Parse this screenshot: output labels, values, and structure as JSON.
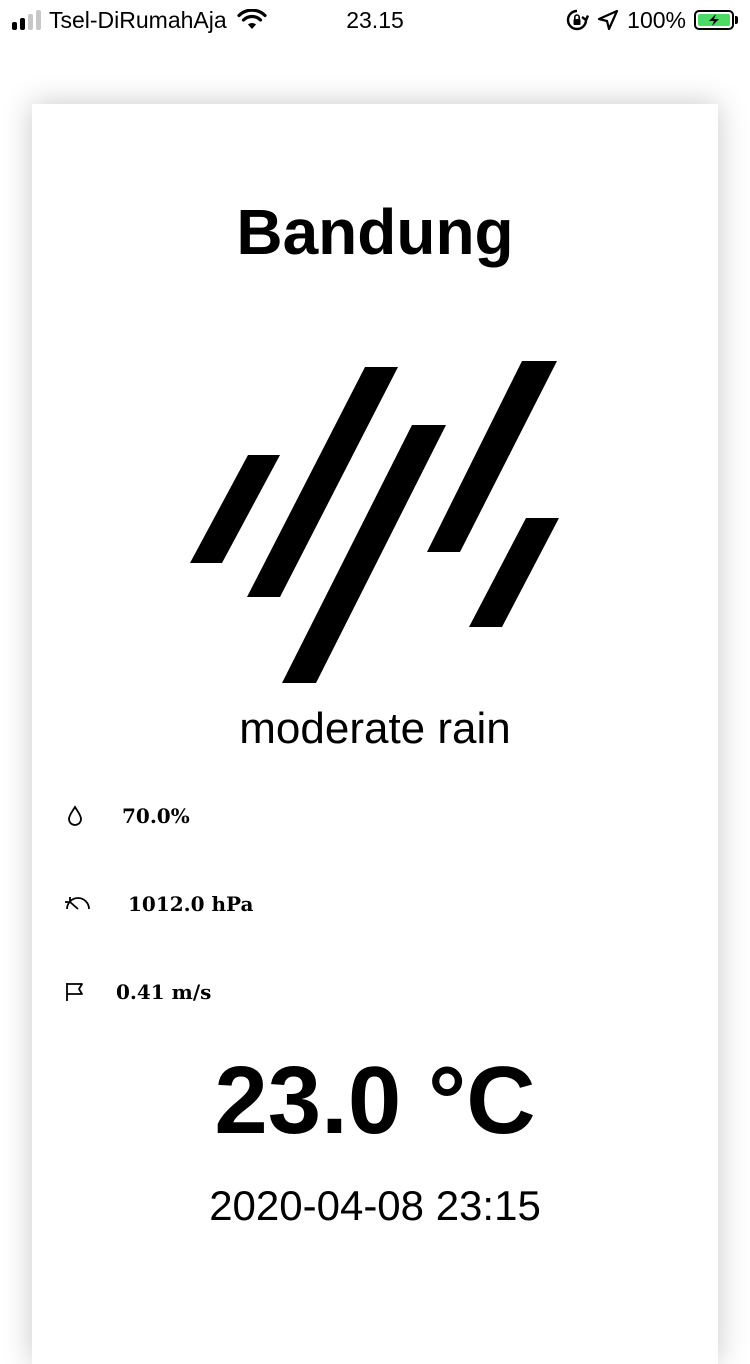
{
  "status_bar": {
    "carrier": "Tsel-DiRumahAja",
    "time": "23.15",
    "battery_percent": "100%",
    "battery_color": "#4cd964",
    "icons": [
      "signal-icon",
      "wifi-icon",
      "rotation-lock-icon",
      "location-arrow-icon",
      "battery-charging-icon"
    ]
  },
  "weather": {
    "city": "Bandung",
    "icon": "moderate-rain-icon",
    "description": "moderate rain",
    "humidity": "70.0%",
    "pressure": "1012.0 hPa",
    "wind_speed": "0.41 m/s",
    "temperature": "23.0 °C",
    "datetime": "2020-04-08 23:15"
  },
  "detail_icons": [
    "humidity-drop-icon",
    "pressure-gauge-icon",
    "wind-flag-icon"
  ]
}
